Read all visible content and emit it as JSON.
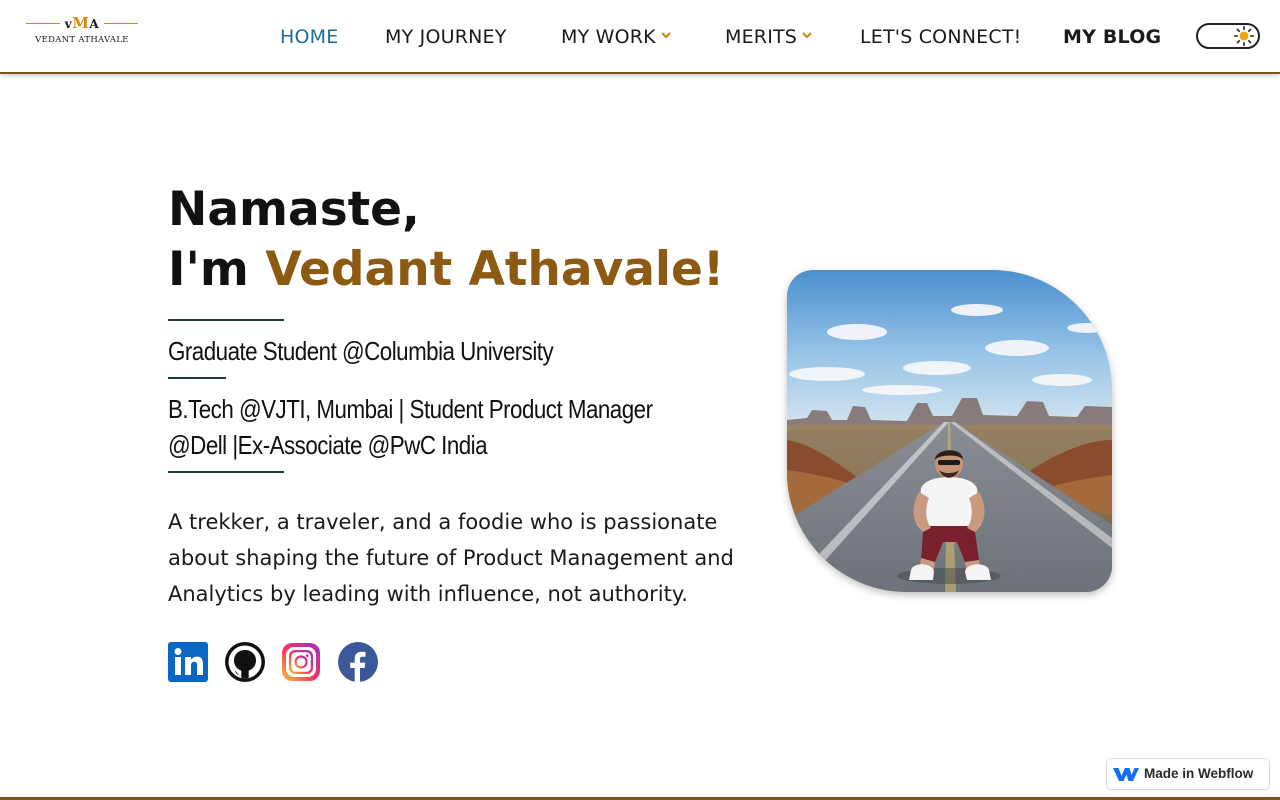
{
  "brand": {
    "logo_mark_pre": "v",
    "logo_mark_m": "M",
    "logo_mark_post": "A",
    "logo_text": "VEDANT ATHAVALE",
    "accent_color": "#8c5a12",
    "logo_accent": "#d48a10",
    "nav_active_color": "#1d6b98",
    "border_color": "#7a5418"
  },
  "nav": {
    "home": "HOME",
    "journey": "MY JOURNEY",
    "work": "MY WORK",
    "merits": "MERITS",
    "connect": "LET'S CONNECT!",
    "blog": "MY BLOG",
    "theme_toggle_icon": "sun-icon"
  },
  "hero": {
    "greeting": "Namaste,",
    "intro_prefix": "I'm ",
    "name": "Vedant Athavale!",
    "line1": "Graduate Student @Columbia University",
    "line2a": "B.Tech @VJTI, Mumbai | Student Product Manager",
    "line2b": "@Dell |Ex-Associate @PwC India",
    "bio": "A trekker, a traveler, and a foodie who is passionate about shaping the future of Product Management and Analytics by leading with influence, not authority."
  },
  "socials": [
    {
      "name": "linkedin-icon",
      "color": "#0a66c2"
    },
    {
      "name": "github-icon",
      "color": "#111111"
    },
    {
      "name": "instagram-icon",
      "color": "#e1306c"
    },
    {
      "name": "facebook-icon",
      "color": "#3b5998"
    }
  ],
  "badge": {
    "text": "Made in Webflow",
    "icon": "webflow-icon"
  }
}
